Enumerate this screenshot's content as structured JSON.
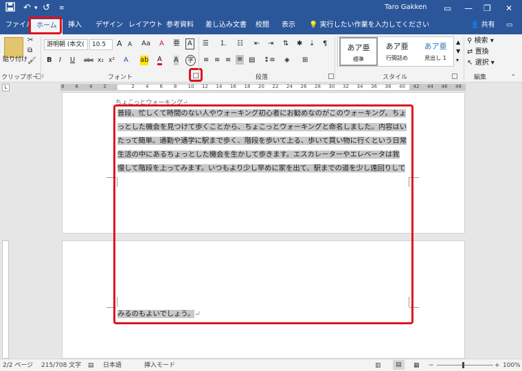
{
  "titlebar": {
    "save_icon": "save-icon",
    "undo_icon": "undo-icon",
    "redo_icon": "redo-icon",
    "customize_icon": "customize-qat-icon",
    "user": "Taro Gakken",
    "minimize": "—",
    "restore": "❐",
    "close": "✕",
    "ribbon_opt": "▭"
  },
  "tabs": [
    {
      "label": "ファイル"
    },
    {
      "label": "ホーム"
    },
    {
      "label": "挿入"
    },
    {
      "label": "デザイン"
    },
    {
      "label": "レイアウト"
    },
    {
      "label": "参考資料"
    },
    {
      "label": "差し込み文書"
    },
    {
      "label": "校閲"
    },
    {
      "label": "表示"
    }
  ],
  "tellme": "実行したい作業を入力してください",
  "share": "共有",
  "ribbon": {
    "clipboard": {
      "paste": "貼り付け",
      "label": "クリップボード"
    },
    "font": {
      "name": "游明朝 (本文(",
      "size": "10.5",
      "grow": "A",
      "shrink": "A",
      "case": "Aa",
      "clear": "A",
      "phonetic": "亜",
      "border_char": "A",
      "bold": "B",
      "italic": "I",
      "underline": "U",
      "strike": "abc",
      "sub": "x₂",
      "sup": "x²",
      "effects": "A",
      "highlight": "ab",
      "color": "A",
      "shade": "A",
      "enclose": "字",
      "label": "フォント"
    },
    "paragraph": {
      "label": "段落"
    },
    "styles": {
      "items": [
        {
          "sample": "あア亜",
          "name": "標準"
        },
        {
          "sample": "あア亜",
          "name": "行間詰め"
        },
        {
          "sample": "あア亜",
          "name": "見出し 1"
        }
      ],
      "label": "スタイル"
    },
    "editing": {
      "find": "検索",
      "replace": "置換",
      "select": "選択",
      "label": "編集"
    }
  },
  "ruler": {
    "numbers": [
      "8",
      "6",
      "4",
      "2",
      "",
      "2",
      "4",
      "6",
      "8",
      "10",
      "12",
      "14",
      "16",
      "18",
      "20",
      "22",
      "24",
      "26",
      "28",
      "30",
      "32",
      "34",
      "36",
      "38",
      "40",
      "42",
      "44",
      "46",
      "48"
    ]
  },
  "document": {
    "heading": "ちょこっとウォーキング",
    "lines": [
      "普段、忙しくて時間のない人やウォーキング初心者にお勧めなのがこのウォーキング。ちょ",
      "っとした機会を見つけて歩くことから、ちょこっとウォーキングと命名しました。内容はい",
      "たって簡単。通勤や通学に駅まで歩く、階段を歩いて上る、歩いて買い物に行くという日常",
      "生活の中にあるちょっとした機会を生かして歩きます。エスカレーターやエレベータは我",
      "慢して階段を上ってみます。いつもより少し早めに家を出て、駅までの道を少し遠回りして"
    ],
    "last_line": "みるのもよいでしょう。"
  },
  "status": {
    "page": "2/2 ページ",
    "words": "215/708 文字",
    "lang": "日本語",
    "mode": "挿入モード",
    "zoom": "100%"
  },
  "colors": {
    "brand": "#2b579a",
    "highlight_box": "#e0101e"
  }
}
